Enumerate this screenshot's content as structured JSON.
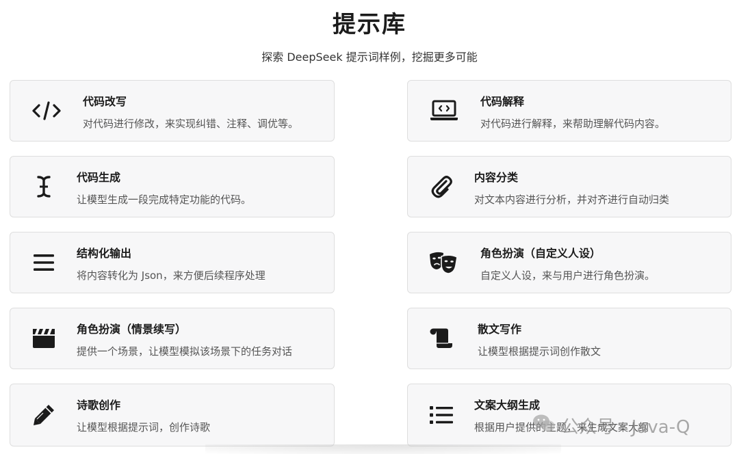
{
  "header": {
    "title": "提示库",
    "subtitle": "探索 DeepSeek 提示词样例，挖掘更多可能"
  },
  "cards": [
    {
      "icon": "code-icon",
      "title": "代码改写",
      "desc": "对代码进行修改，来实现纠错、注释、调优等。"
    },
    {
      "icon": "laptop-code-icon",
      "title": "代码解释",
      "desc": "对代码进行解释，来帮助理解代码内容。"
    },
    {
      "icon": "text-cursor-icon",
      "title": "代码生成",
      "desc": "让模型生成一段完成特定功能的代码。"
    },
    {
      "icon": "paperclip-icon",
      "title": "内容分类",
      "desc": "对文本内容进行分析，并对齐进行自动归类"
    },
    {
      "icon": "menu-lines-icon",
      "title": "结构化输出",
      "desc": "将内容转化为 Json，来方便后续程序处理"
    },
    {
      "icon": "theater-masks-icon",
      "title": "角色扮演（自定义人设）",
      "desc": "自定义人设，来与用户进行角色扮演。"
    },
    {
      "icon": "clapperboard-icon",
      "title": "角色扮演（情景续写）",
      "desc": "提供一个场景，让模型模拟该场景下的任务对话"
    },
    {
      "icon": "scroll-icon",
      "title": "散文写作",
      "desc": "让模型根据提示词创作散文"
    },
    {
      "icon": "pencil-icon",
      "title": "诗歌创作",
      "desc": "让模型根据提示词，创作诗歌"
    },
    {
      "icon": "list-icon",
      "title": "文案大纲生成",
      "desc": "根据用户提供的主题，来生成文案大纲"
    }
  ],
  "watermark": {
    "icon": "wechat-icon",
    "text": "公众号 · Java-Q"
  }
}
